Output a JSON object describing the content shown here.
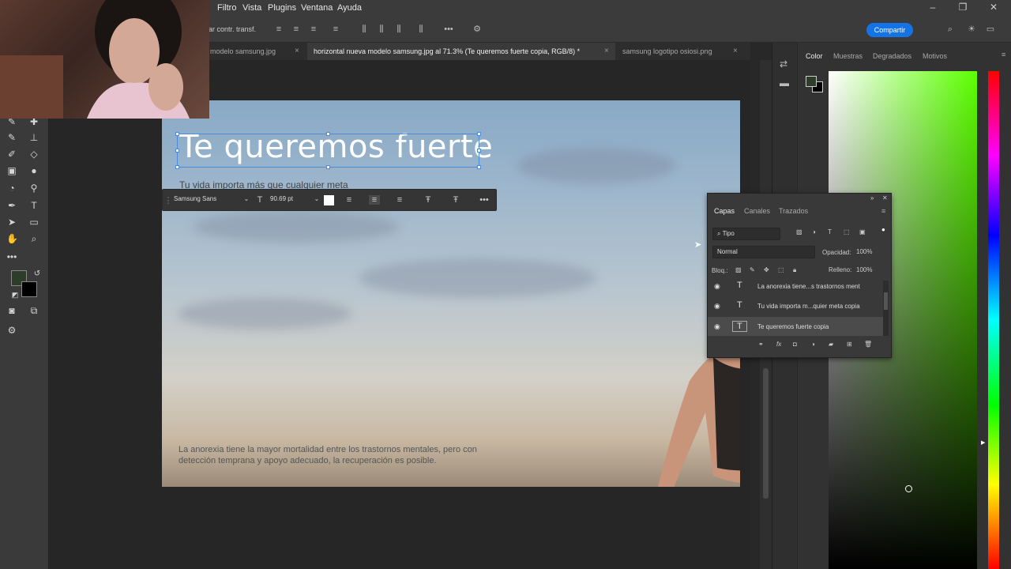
{
  "menu": {
    "items": [
      "Filtro",
      "Vista",
      "Plugins",
      "Ventana",
      "Ayuda"
    ]
  },
  "options_bar": {
    "transform_label": "ar contr. transf.",
    "share_label": "Compartir"
  },
  "tabs": [
    {
      "label": "modelo samsung.jpg",
      "active": false
    },
    {
      "label": "horizontal nueva modelo samsung.jpg al 71.3% (Te queremos fuerte copia, RGB/8) *",
      "active": true
    },
    {
      "label": "samsung logotipo osiosi.png",
      "active": false
    }
  ],
  "canvas": {
    "headline": "Te queremos fuerte",
    "subline": "Tu vida importa más que cualquier meta",
    "body": "La anorexia tiene la mayor mortalidad entre los trastornos mentales, pero con detección temprana y apoyo adecuado, la recuperación es posible."
  },
  "context_bar": {
    "font": "Samsung Sans",
    "size": "90.69 pt"
  },
  "color_panel": {
    "tabs": [
      "Color",
      "Muestras",
      "Degradados",
      "Motivos"
    ],
    "foreground": "#2e3d2a",
    "background": "#000000"
  },
  "layers_panel": {
    "tabs": [
      "Capas",
      "Canales",
      "Trazados"
    ],
    "filter": "Tipo",
    "blend_mode": "Normal",
    "opacity_label": "Opacidad:",
    "opacity": "100%",
    "lock_label": "Bloq.:",
    "fill_label": "Relleno:",
    "fill": "100%",
    "layers": [
      {
        "name": "La anorexia tiene...s trastornos ment",
        "selected": false
      },
      {
        "name": "Tu vida importa m...quier meta copia",
        "selected": false
      },
      {
        "name": "Te queremos fuerte copia",
        "selected": true
      }
    ]
  },
  "toolbar_colors": {
    "foreground": "#2e3d2a",
    "background": "#000000"
  }
}
